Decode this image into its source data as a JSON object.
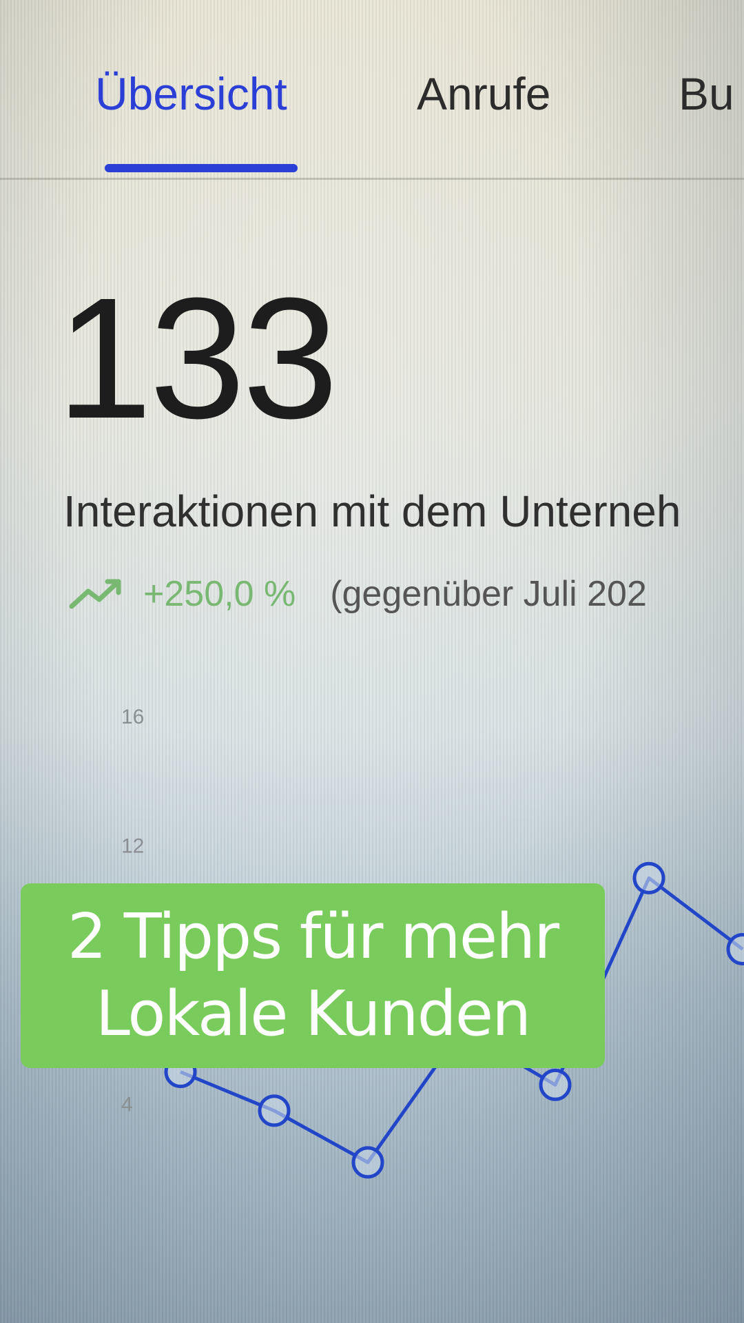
{
  "tabs": [
    {
      "label": "Übersicht",
      "active": true
    },
    {
      "label": "Anrufe",
      "active": false
    },
    {
      "label": "Bu",
      "active": false
    }
  ],
  "metric": {
    "value": "133",
    "label": "Interaktionen mit dem Unterneh",
    "trend_value": "+250,0 %",
    "trend_compare": "(gegenüber Juli 202",
    "trend_icon": "trending-up-icon"
  },
  "overlay": {
    "line1": "2 Tipps für mehr",
    "line2": "Lokale Kunden"
  },
  "colors": {
    "accent": "#2b3fd6",
    "trend_positive": "#79b872",
    "overlay_bg": "#79cc5c",
    "line": "#2346c8"
  },
  "chart_data": {
    "type": "line",
    "y_ticks": [
      "16",
      "12",
      "4"
    ],
    "ylim": [
      0,
      16
    ],
    "series": [
      {
        "values": [
          5,
          3.8,
          2.2,
          6.3,
          4.6,
          11,
          8.8
        ]
      }
    ]
  }
}
